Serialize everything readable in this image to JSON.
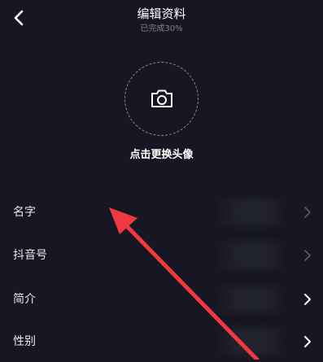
{
  "header": {
    "title": "编辑资料",
    "subtitle": "已完成30%"
  },
  "avatar": {
    "label": "点击更换头像",
    "icon": "camera-icon"
  },
  "rows": [
    {
      "label": "名字",
      "chevron_color": "#5c5d66"
    },
    {
      "label": "抖音号",
      "chevron_color": "#5c5d66"
    },
    {
      "label": "简介",
      "chevron_color": "#ffffff"
    },
    {
      "label": "性别",
      "chevron_color": "#ffffff"
    }
  ],
  "colors": {
    "background": "#161722",
    "annotation_arrow": "#f0383f"
  }
}
